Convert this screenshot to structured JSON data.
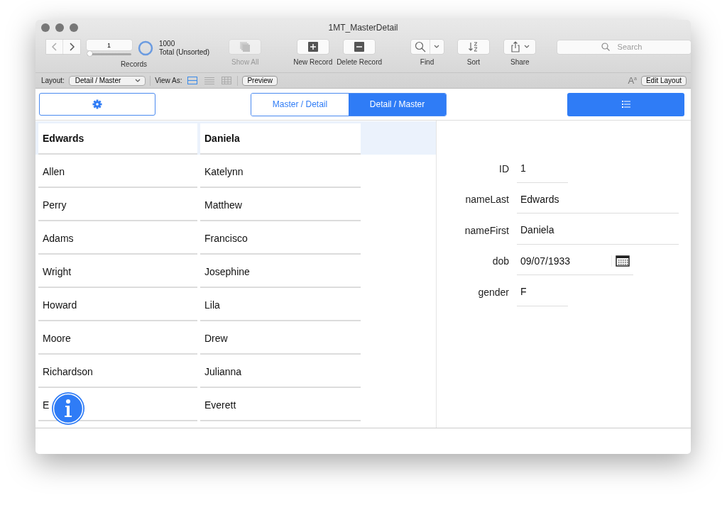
{
  "window": {
    "title": "1MT_MasterDetail"
  },
  "toolbar": {
    "record_field": "1",
    "record_slider": {
      "level": 0
    },
    "records_label": "Records",
    "found_count": "1000",
    "total_status": "Total (Unsorted)",
    "buttons": [
      {
        "kind": "show-all",
        "label": "Show All",
        "disabled": true
      },
      {
        "kind": "new",
        "label": "New Record",
        "disabled": false
      },
      {
        "kind": "delete",
        "label": "Delete Record",
        "disabled": false
      },
      {
        "kind": "find",
        "label": "Find",
        "disabled": false
      },
      {
        "kind": "sort",
        "label": "Sort",
        "disabled": false
      },
      {
        "kind": "share",
        "label": "Share",
        "disabled": false
      }
    ],
    "search": {
      "placeholder": "Search"
    }
  },
  "layout_bar": {
    "layout_label": "Layout:",
    "layout_value": "Detail / Master",
    "view_as_label": "View As:",
    "view_modes": [
      {
        "kind": "form",
        "selected": true
      },
      {
        "kind": "list",
        "selected": false
      },
      {
        "kind": "table",
        "selected": false
      }
    ],
    "preview_button": "Preview",
    "text_size_button": "A$^{a}$",
    "edit_layout_button": "Edit Layout"
  },
  "header": {
    "segments": [
      {
        "label": "Master / Detail",
        "selected": false
      },
      {
        "label": "Detail / Master",
        "selected": true
      }
    ]
  },
  "list": {
    "rows": [
      {
        "last": "Edwards",
        "first": "Daniela",
        "selected": true
      },
      {
        "last": "Allen",
        "first": "Katelynn",
        "selected": false
      },
      {
        "last": "Perry",
        "first": "Matthew",
        "selected": false
      },
      {
        "last": "Adams",
        "first": "Francisco",
        "selected": false
      },
      {
        "last": "Wright",
        "first": "Josephine",
        "selected": false
      },
      {
        "last": "Howard",
        "first": "Lila",
        "selected": false
      },
      {
        "last": "Moore",
        "first": "Drew",
        "selected": false
      },
      {
        "last": "Richardson",
        "first": "Julianna",
        "selected": false
      },
      {
        "last": "E",
        "first": "Everett",
        "selected": false
      }
    ]
  },
  "detail": {
    "fields": [
      {
        "kind": "short",
        "label": "ID",
        "value": "1"
      },
      {
        "kind": "wide",
        "label": "nameLast",
        "value": "Edwards"
      },
      {
        "kind": "wide",
        "label": "nameFirst",
        "value": "Daniela"
      },
      {
        "kind": "date",
        "label": "dob",
        "value": "09/07/1933"
      },
      {
        "kind": "short",
        "label": "gender",
        "value": "F"
      }
    ]
  }
}
